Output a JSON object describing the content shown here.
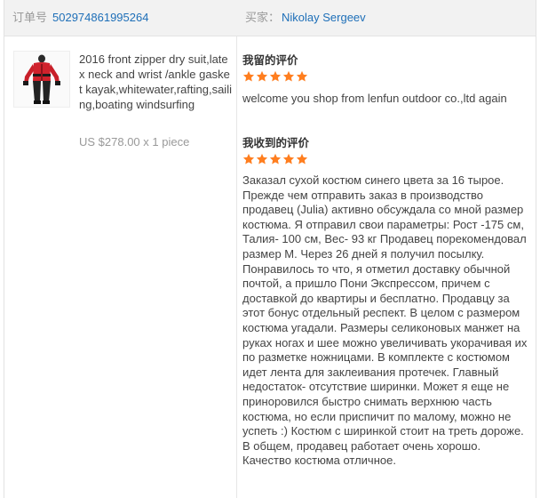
{
  "header": {
    "order_label": "订单号",
    "order_id": "502974861995264",
    "buyer_label": "买家：",
    "buyer_name": "Nikolay Sergeev"
  },
  "product": {
    "icon": "drysuit-product-thumbnail",
    "title": "2016 front zipper dry suit,latex neck and wrist /ankle gasket kayak,whitewater,rafting,sailing,boating windsurfing",
    "price": "US $278.00 x 1 piece"
  },
  "my_feedback": {
    "heading": "我留的评价",
    "stars": 5,
    "text": "welcome you shop from lenfun outdoor co.,ltd again"
  },
  "received_feedback": {
    "heading": "我收到的评价",
    "stars": 5,
    "text": "Заказал сухой костюм синего цвета за 16 тырое. Прежде чем отправить заказ в производство продавец (Julia) активно обсуждала со мной размер костюма. Я отправил свои параметры: Рост -175 см, Талия- 100 см, Вес- 93 кг Продавец порекомендовал размер М. Через 26 дней я получил посылку. Понравилось то что, я отметил доставку обычной почтой, а пришло Пони Экспрессом, причем с доставкой до квартиры и бесплатно. Продавцу за этот бонус отдельный респект. В целом с размером костюма угадали. Размеры селиконовых манжет на руках ногах и шее можно увеличивать укорачивая их по разметке ножницами. В комплекте с костюмом идет лента для заклеивания протечек. Главный недостаток- отсутствие ширинки. Может я еще не приноровился быстро снимать верхнюю часть костюма, но если приспичит по малому, можно не успеть :) Костюм с ширинкой стоит на треть дороже. В общем, продавец работает очень хорошо. Качество костюма отличное."
  },
  "colors": {
    "link": "#1e6fb8",
    "star": "#ff7e1f",
    "header_bg": "#f2f2f2"
  }
}
